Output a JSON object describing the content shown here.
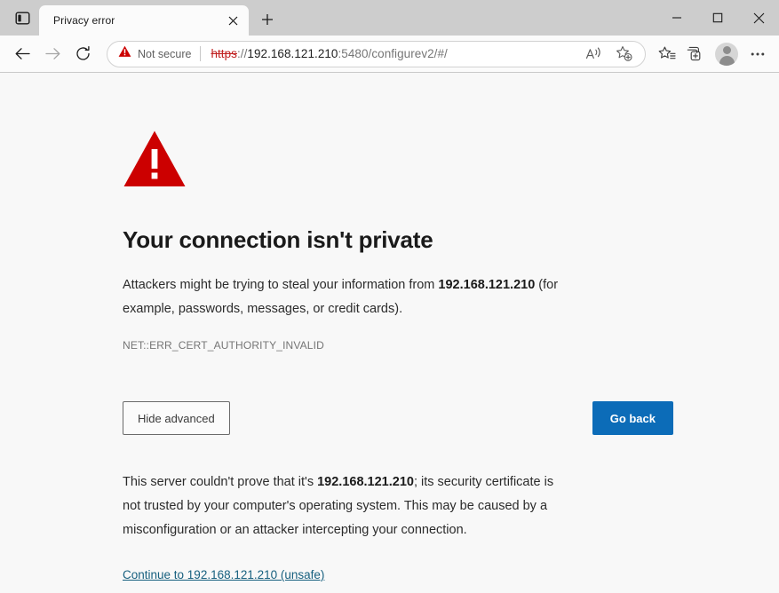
{
  "window": {
    "titlebar": {
      "tab_actions_icon": "tab-actions-icon",
      "minimize_label": "–",
      "maximize_label": "□",
      "close_label": "✕",
      "new_tab_label": "+"
    },
    "tabs": [
      {
        "title": "Privacy error",
        "close_label": "✕",
        "active": true
      }
    ]
  },
  "toolbar": {
    "back_icon": "back-arrow-icon",
    "forward_icon": "forward-arrow-icon",
    "reload_icon": "reload-icon",
    "omnibox": {
      "security_icon": "warning-triangle-icon",
      "security_label": "Not secure",
      "url_scheme": "https",
      "url_separator": "://",
      "url_host": "192.168.121.210",
      "url_rest": ":5480/configurev2/#/",
      "url_full": "https://192.168.121.210:5480/configurev2/#/",
      "read_aloud_icon": "read-aloud-icon",
      "add_favorite_icon": "add-favorite-star-icon"
    },
    "favorites_icon": "favorites-star-list-icon",
    "collections_icon": "collections-icon",
    "profile_icon": "profile-avatar-icon",
    "settings_icon": "settings-more-icon"
  },
  "page": {
    "warning_icon": "red-warning-triangle-icon",
    "headline": "Your connection isn't private",
    "body_before_host": "Attackers might be trying to steal your information from ",
    "body_host": "192.168.121.210",
    "body_after_host": " (for example, passwords, messages, or credit cards).",
    "error_code": "NET::ERR_CERT_AUTHORITY_INVALID",
    "hide_advanced_label": "Hide advanced",
    "go_back_label": "Go back",
    "advanced_before_host": "This server couldn't prove that it's ",
    "advanced_host": "192.168.121.210",
    "advanced_after_host": "; its security certificate is not trusted by your computer's operating system. This may be caused by a misconfiguration or an attacker intercepting your connection.",
    "continue_link_label": "Continue to 192.168.121.210 (unsafe)"
  },
  "colors": {
    "warning_red": "#cc0000",
    "primary_blue": "#0c6cb8",
    "link_teal": "#17607f",
    "titlebar_gray": "#cdcdcd",
    "page_bg": "#f8f8f8"
  }
}
